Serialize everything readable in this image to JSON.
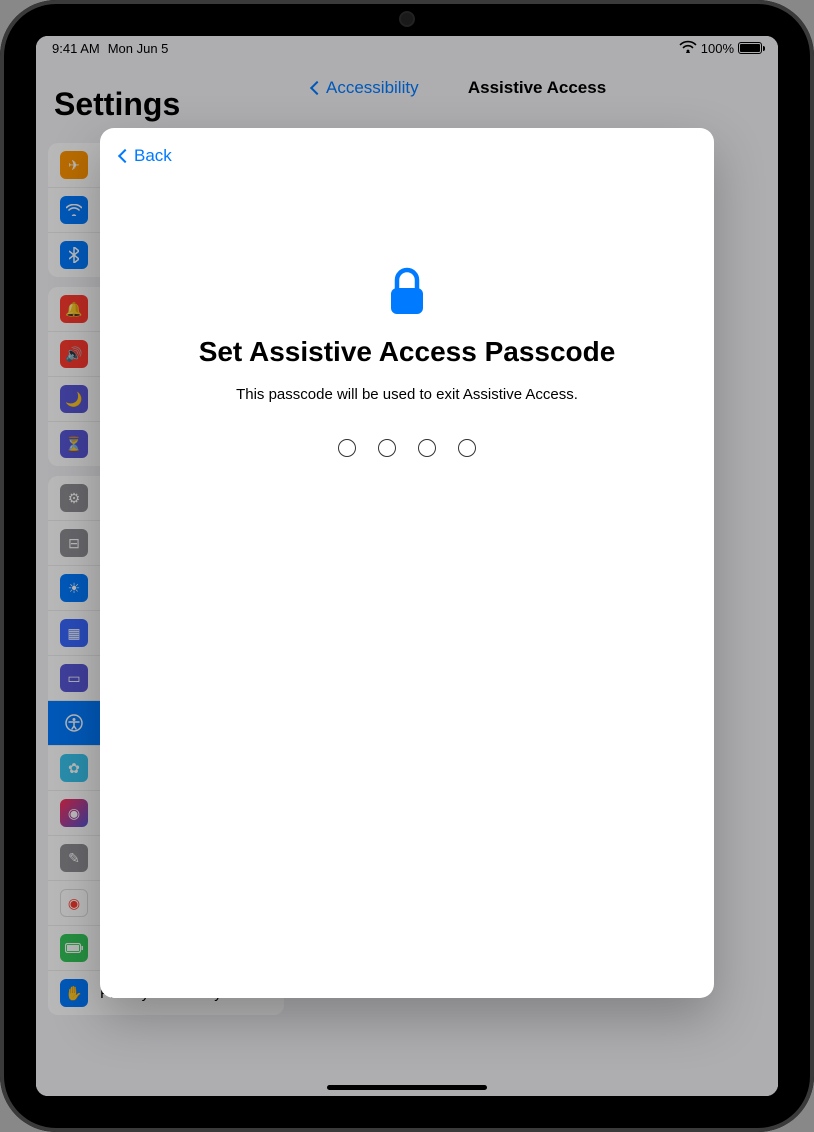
{
  "status": {
    "time": "9:41 AM",
    "date": "Mon Jun 5",
    "battery": "100%"
  },
  "settings_title": "Settings",
  "sidebar": {
    "visible_items": [
      {
        "label": "Battery",
        "icon_color": "#34c759"
      },
      {
        "label": "Privacy & Security",
        "icon_color": "#007aff"
      }
    ]
  },
  "detail": {
    "back_label": "Accessibility",
    "title": "Assistive Access"
  },
  "modal": {
    "back_label": "Back",
    "title": "Set Assistive Access Passcode",
    "subtitle": "This passcode will be used to exit Assistive Access.",
    "passcode_length": 4
  },
  "colors": {
    "accent": "#007aff"
  }
}
